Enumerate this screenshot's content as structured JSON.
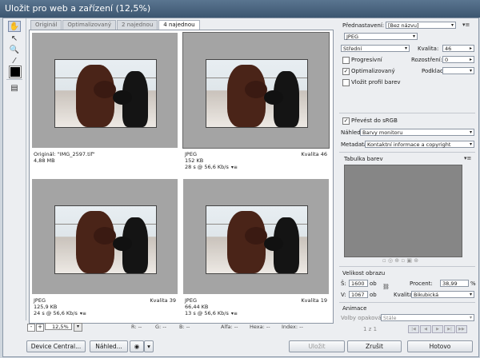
{
  "window": {
    "title": "Uložit pro web a zařízení (12,5%)"
  },
  "tabs": [
    "Originál",
    "Optimalizovaný",
    "2 najednou",
    "4 najednou"
  ],
  "active_tab": 3,
  "panes": [
    {
      "format": "Originál: \"IMG_2597.tif\"",
      "size": "4,88 MB",
      "time": "",
      "quality": ""
    },
    {
      "format": "JPEG",
      "size": "152 KB",
      "time": "28 s @ 56,6 Kb/s",
      "quality": "Kvalita 46"
    },
    {
      "format": "JPEG",
      "size": "125,9 KB",
      "time": "24 s @ 56,6 Kb/s",
      "quality": "Kvalita 39"
    },
    {
      "format": "JPEG",
      "size": "66,44 KB",
      "time": "13 s @ 56,6 Kb/s",
      "quality": "Kvalita 19"
    }
  ],
  "zoom": {
    "minus": "-",
    "plus": "+",
    "value": "12,5%"
  },
  "readouts": {
    "r": "R: --",
    "g": "G: --",
    "b": "B: --",
    "alpha": "Alfa: --",
    "hexa": "Hexa: --",
    "index": "Index: --"
  },
  "settings": {
    "preset_label": "Přednastavení:",
    "preset_value": "[Bez názvu]",
    "format": "JPEG",
    "compression": "Střední",
    "quality_label": "Kvalita:",
    "quality_value": "46",
    "progressive": "Progresivní",
    "blur_label": "Rozostření:",
    "blur_value": "0",
    "optimized": "Optimalizovaný",
    "matte_label": "Podklad:",
    "embed_profile": "Vložit profil barev",
    "convert_srgb": "Převést do sRGB",
    "preview_label": "Náhled:",
    "preview_value": "Barvy monitoru",
    "metadata_label": "Metadata:",
    "metadata_value": "Kontaktní informace a copyright",
    "color_table": "Tabulka barev"
  },
  "image_size": {
    "title": "Velikost obrazu",
    "w_label": "Š:",
    "w_value": "1600",
    "h_label": "V:",
    "h_value": "1067",
    "unit": "ob",
    "percent_label": "Procent:",
    "percent_value": "38,99",
    "percent_unit": "%",
    "quality_label": "Kvalita:",
    "quality_value": "Bikubická"
  },
  "animation": {
    "title": "Animace",
    "loop_label": "Volby opakování:",
    "loop_value": "Stále",
    "frame": "1 z 1"
  },
  "buttons": {
    "device_central": "Device Central...",
    "preview": "Náhled...",
    "save": "Uložit",
    "cancel": "Zrušit",
    "done": "Hotovo"
  }
}
